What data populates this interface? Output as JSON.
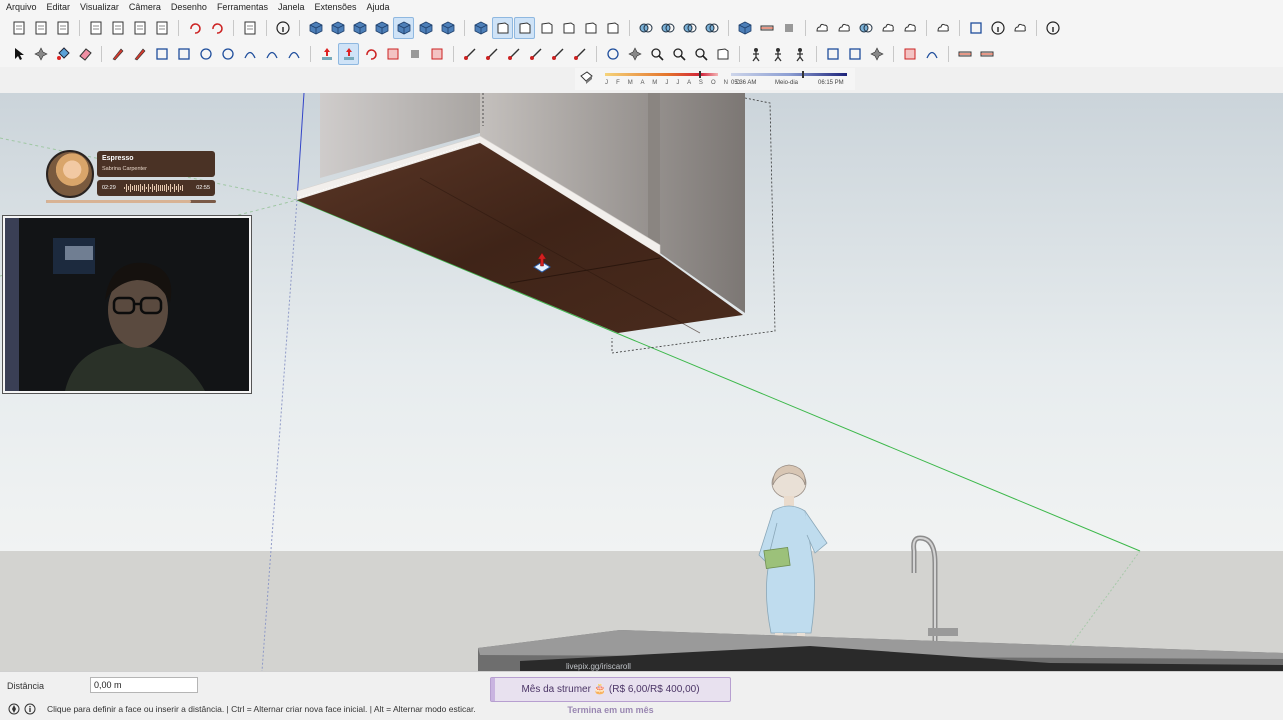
{
  "menu": {
    "items": [
      "Arquivo",
      "Editar",
      "Visualizar",
      "Câmera",
      "Desenho",
      "Ferramentas",
      "Janela",
      "Extensões",
      "Ajuda"
    ]
  },
  "toolbar1": {
    "icons": [
      "new-file-icon",
      "open-folder-icon",
      "save-icon",
      "sep",
      "cut-icon",
      "copy-icon",
      "paste-icon",
      "delete-icon",
      "sep",
      "undo-icon",
      "redo-icon",
      "sep",
      "print-icon",
      "sep",
      "model-info-icon",
      "sep",
      "xray-icon",
      "back-edges-icon",
      "wireframe-icon",
      "hidden-line-icon",
      "shaded-icon",
      "shaded-textures-icon",
      "monochrome-icon",
      "sep",
      "iso-view-icon",
      "top-view-icon",
      "front-view-icon",
      "right-view-icon",
      "back-view-icon",
      "left-view-icon",
      "bottom-view-icon",
      "sep",
      "solid-union-icon",
      "solid-intersect-icon",
      "solid-subtract-icon",
      "solid-trim-icon",
      "sep",
      "components-icon",
      "section-plane-icon",
      "scenes-icon",
      "sep",
      "add-location-icon",
      "photo-texture-icon",
      "terrain-icon",
      "3d-warehouse-icon",
      "cloud-icon",
      "sep",
      "extension-manager-icon",
      "sep",
      "layout-icon",
      "info-icon",
      "store-icon",
      "sep",
      "account-icon"
    ],
    "active": [
      20,
      25,
      26
    ]
  },
  "toolbar2": {
    "icons": [
      "select-arrow-icon",
      "component-icon",
      "paint-bucket-icon",
      "eraser-icon",
      "sep",
      "pencil-line-icon",
      "freehand-icon",
      "rectangle-icon",
      "rotated-rectangle-icon",
      "circle-icon",
      "polygon-icon",
      "arc-icon",
      "two-point-arc-icon",
      "pie-icon",
      "sep",
      "move-icon",
      "push-pull-icon",
      "rotate-icon",
      "scale-icon",
      "follow-me-icon",
      "offset-icon",
      "sep",
      "tape-measure-icon",
      "dimension-icon",
      "protractor-icon",
      "text-icon",
      "axes-icon",
      "3d-text-icon",
      "sep",
      "orbit-icon",
      "pan-icon",
      "zoom-icon",
      "zoom-window-icon",
      "zoom-extents-icon",
      "previous-view-icon",
      "sep",
      "position-camera-icon",
      "look-around-icon",
      "walk-icon",
      "sep",
      "sandbox-icon",
      "box-icon",
      "smoove-icon",
      "sep",
      "mirror-icon",
      "curve-icon",
      "sep",
      "sections-icon",
      "section-fill-icon"
    ],
    "active": [
      16
    ]
  },
  "shadow": {
    "months": "J F M A M J J A S O N D",
    "time_start": "05:36 AM",
    "time_mid": "Meio-dia",
    "time_end": "06:15 PM"
  },
  "music": {
    "title": "Espresso",
    "artist": "Sabrina Carpenter",
    "current_time": "02:29",
    "total_time": "02:55",
    "progress": 0.85
  },
  "measure": {
    "label": "Distância",
    "value": "0,00 m"
  },
  "status": {
    "text": "Clique para definir a face ou inserir a distância. | Ctrl = Alternar criar nova face inicial. | Alt = Alternar modo esticar."
  },
  "overlay": {
    "goal_text": "Mês da strumer 🎂 (R$ 6,00/R$ 400,00)",
    "goal_progress": 0.015,
    "goal_sub": "Termina em um mês",
    "floor_caption": "livepix.gg/iriscaroll"
  },
  "colors": {
    "wood": "#3f2418",
    "sky": "#dfe6ea",
    "ground": "#d2d2cf",
    "green_axis": "#3cb84a",
    "red_axis": "#d2343a",
    "blue_axis": "#3345c8",
    "goal_purple": "#b79fd0"
  }
}
